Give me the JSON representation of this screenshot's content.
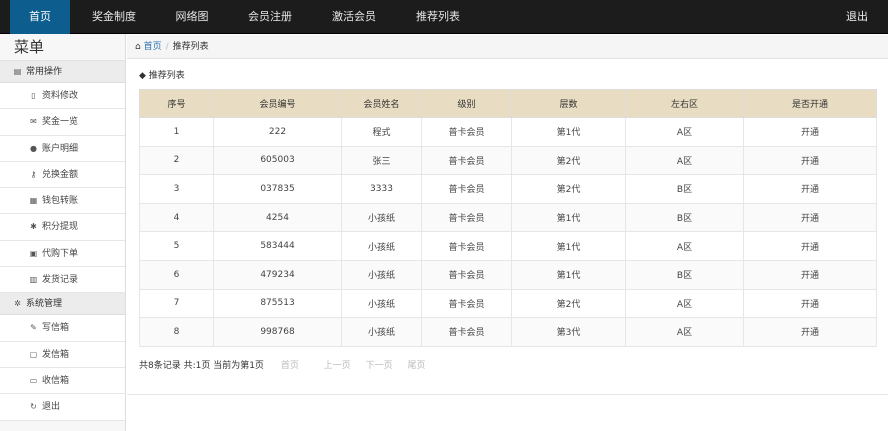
{
  "nav": {
    "items": [
      {
        "label": "首页",
        "active": true
      },
      {
        "label": "奖金制度",
        "active": false
      },
      {
        "label": "网络图",
        "active": false
      },
      {
        "label": "会员注册",
        "active": false
      },
      {
        "label": "激活会员",
        "active": false
      },
      {
        "label": "推荐列表",
        "active": false
      }
    ],
    "logout": "退出"
  },
  "sidebar": {
    "title": "菜单",
    "groups": [
      {
        "label": "常用操作",
        "icon": "list-icon",
        "items": [
          {
            "label": "资料修改",
            "icon": "document-icon"
          },
          {
            "label": "奖金一览",
            "icon": "envelope-icon"
          },
          {
            "label": "账户明细",
            "icon": "comment-icon"
          },
          {
            "label": "兑换金额",
            "icon": "key-icon"
          },
          {
            "label": "钱包转账",
            "icon": "grid-icon"
          },
          {
            "label": "积分提现",
            "icon": "gear-icon"
          },
          {
            "label": "代购下单",
            "icon": "form-icon"
          },
          {
            "label": "发货记录",
            "icon": "chart-icon"
          }
        ]
      },
      {
        "label": "系统管理",
        "icon": "cog-icon",
        "items": [
          {
            "label": "写信箱",
            "icon": "wrench-icon"
          },
          {
            "label": "发信箱",
            "icon": "trash-icon"
          },
          {
            "label": "收信箱",
            "icon": "inbox-icon"
          },
          {
            "label": "退出",
            "icon": "refresh-icon"
          }
        ]
      }
    ]
  },
  "breadcrumb": {
    "home": "首页",
    "current": "推荐列表"
  },
  "section": {
    "label": "推荐列表"
  },
  "table": {
    "headers": [
      "序号",
      "会员编号",
      "会员姓名",
      "级别",
      "层数",
      "左右区",
      "是否开通"
    ],
    "rows": [
      [
        "1",
        "222",
        "程式",
        "普卡会员",
        "第1代",
        "A区",
        "开通"
      ],
      [
        "2",
        "605003",
        "张三",
        "普卡会员",
        "第2代",
        "A区",
        "开通"
      ],
      [
        "3",
        "037835",
        "3333",
        "普卡会员",
        "第2代",
        "B区",
        "开通"
      ],
      [
        "4",
        "4254",
        "小孩纸",
        "普卡会员",
        "第1代",
        "B区",
        "开通"
      ],
      [
        "5",
        "583444",
        "小孩纸",
        "普卡会员",
        "第1代",
        "A区",
        "开通"
      ],
      [
        "6",
        "479234",
        "小孩纸",
        "普卡会员",
        "第1代",
        "B区",
        "开通"
      ],
      [
        "7",
        "875513",
        "小孩纸",
        "普卡会员",
        "第2代",
        "A区",
        "开通"
      ],
      [
        "8",
        "998768",
        "小孩纸",
        "普卡会员",
        "第3代",
        "A区",
        "开通"
      ]
    ]
  },
  "pager": {
    "summary": "共8条记录 共:1页 当前为第1页",
    "first": "首页",
    "prev": "上一页",
    "next": "下一页",
    "last": "尾页"
  }
}
